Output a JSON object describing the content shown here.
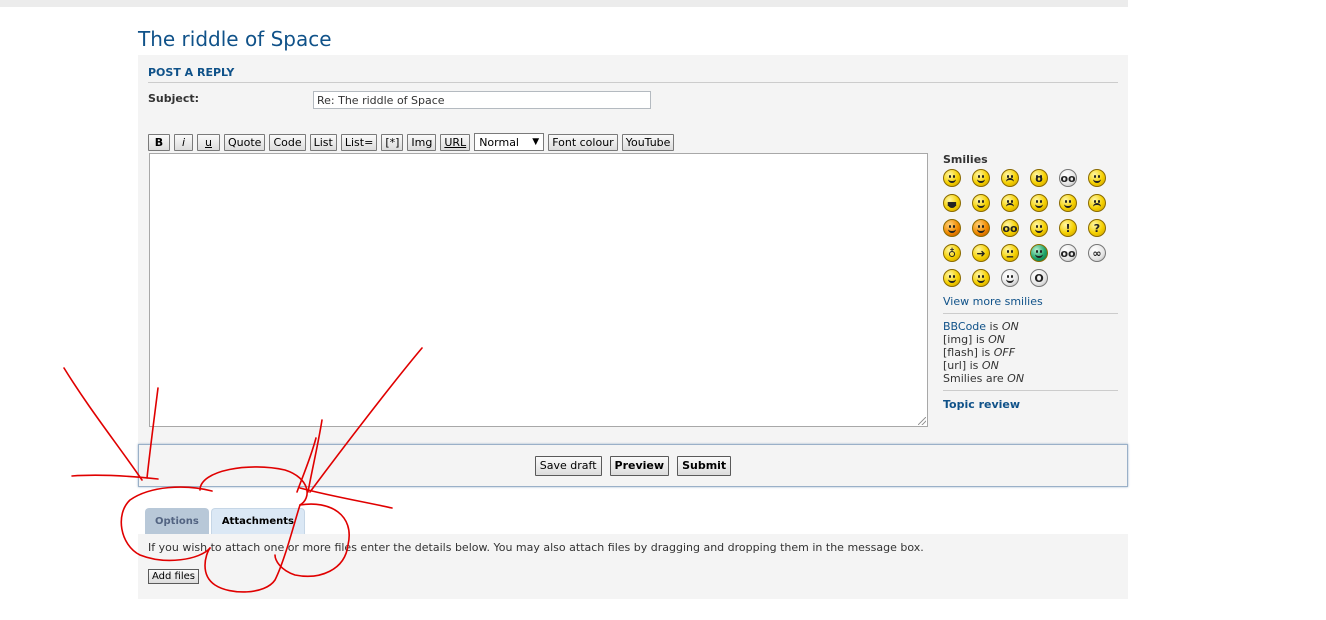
{
  "page": {
    "title": "The riddle of Space"
  },
  "form": {
    "section_title": "POST A REPLY",
    "subject_label": "Subject:",
    "subject_value": "Re: The riddle of Space"
  },
  "toolbar": {
    "bold": "B",
    "italic": "i",
    "underline": "u",
    "quote": "Quote",
    "code": "Code",
    "list": "List",
    "list_ordered": "List=",
    "list_item": "[*]",
    "img": "Img",
    "url": "URL",
    "font_size": "Normal",
    "font_colour": "Font colour",
    "youtube": "YouTube"
  },
  "sidebar": {
    "smilies_title": "Smilies",
    "view_more": "View more smilies",
    "status": {
      "bbcode_label": "BBCode",
      "bbcode_is": " is ",
      "bbcode_value": "ON",
      "img_label": "[img] is ",
      "img_value": "ON",
      "flash_label": "[flash] is ",
      "flash_value": "OFF",
      "url_label": "[url] is ",
      "url_value": "ON",
      "smilies_label": "Smilies are ",
      "smilies_value": "ON"
    },
    "topic_review": "Topic review"
  },
  "submit_bar": {
    "save_draft": "Save draft",
    "preview": "Preview",
    "submit": "Submit"
  },
  "tabs": {
    "options": "Options",
    "attachments": "Attachments"
  },
  "attachments": {
    "instructions": "If you wish to attach one or more files enter the details below. You may also attach files by dragging and dropping them in the message box.",
    "add_files": "Add files"
  },
  "colors": {
    "link_blue": "#105289",
    "panel_bg": "#f4f4f4",
    "annotation_red": "#e00000"
  }
}
